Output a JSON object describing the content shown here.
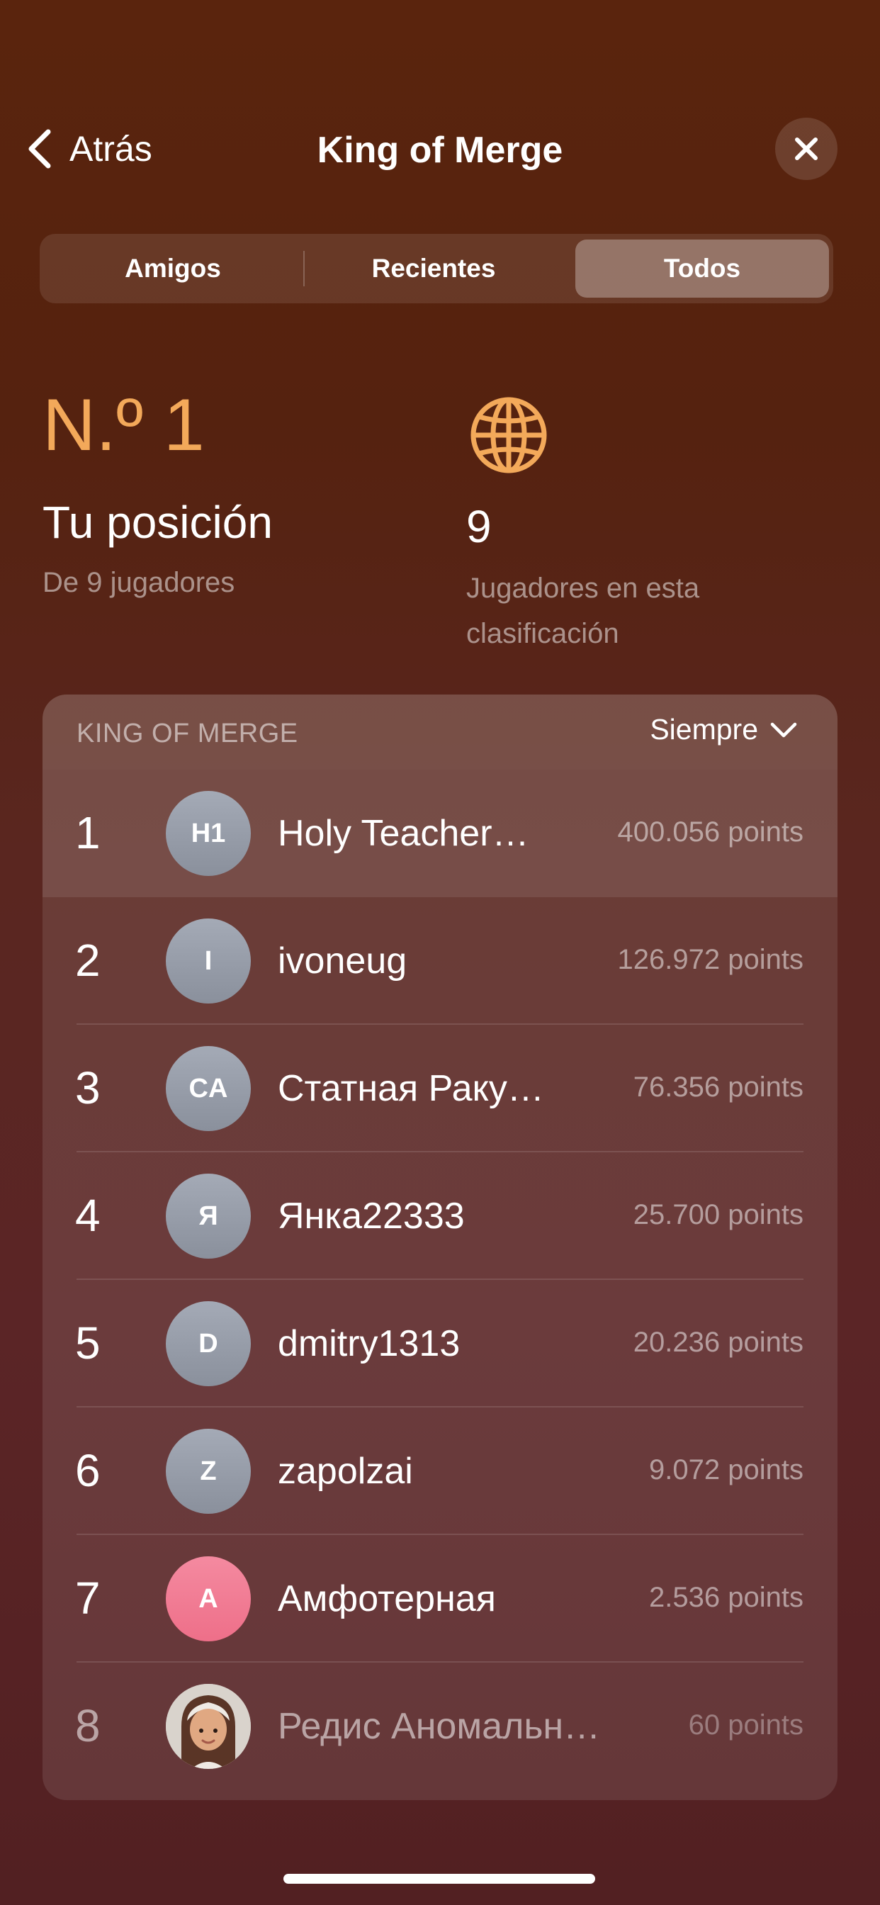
{
  "nav": {
    "back_label": "Atrás",
    "title": "King of Merge",
    "close_icon": "close-icon"
  },
  "tabs": [
    {
      "label": "Amigos",
      "selected": false
    },
    {
      "label": "Recientes",
      "selected": false
    },
    {
      "label": "Todos",
      "selected": true
    }
  ],
  "stats": {
    "rank": "N.º 1",
    "rank_label": "Tu posición",
    "rank_sub": "De 9 jugadores",
    "players_icon": "globe-icon",
    "players_count": "9",
    "players_sub": "Jugadores en esta clasificación"
  },
  "leaderboard": {
    "title": "KING OF MERGE",
    "period": "Siempre",
    "rows": [
      {
        "rank": "1",
        "initials": "H1",
        "name": "Holy Teacher…",
        "points": "400.056 points"
      },
      {
        "rank": "2",
        "initials": "I",
        "name": "ivoneug",
        "points": "126.972 points"
      },
      {
        "rank": "3",
        "initials": "CA",
        "name": "Статная Раку…",
        "points": "76.356 points"
      },
      {
        "rank": "4",
        "initials": "Я",
        "name": "Янка22333",
        "points": "25.700 points"
      },
      {
        "rank": "5",
        "initials": "D",
        "name": "dmitry1313",
        "points": "20.236 points"
      },
      {
        "rank": "6",
        "initials": "Z",
        "name": "zapolzai",
        "points": "9.072 points"
      },
      {
        "rank": "7",
        "initials": "A",
        "name": "Амфотерная",
        "points": "2.536 points"
      },
      {
        "rank": "8",
        "initials": "",
        "name": "Редис Аномальн…",
        "points": "60 points"
      }
    ]
  },
  "colors": {
    "accent": "#f3a95a",
    "avatar_gray": "#9aa0ac",
    "avatar_pink": "#f07b93"
  }
}
